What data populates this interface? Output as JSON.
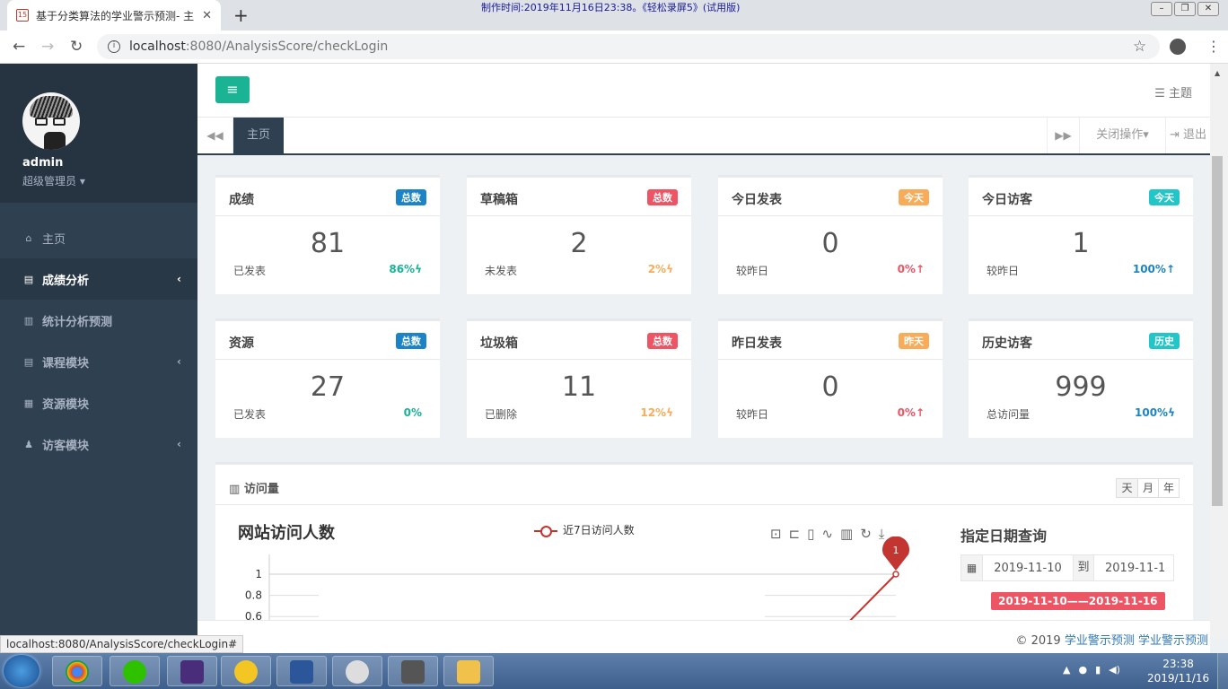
{
  "browser": {
    "tab_title": "基于分类算法的学业警示预测- 主",
    "tab_close": "✕",
    "new_tab": "+",
    "url_host": "localhost",
    "url_rest": ":8080/AnalysisScore/checkLogin",
    "recorder_watermark": "制作时间:2019年11月16日23:38。《轻松录屏5》(试用版)",
    "status_url": "localhost:8080/AnalysisScore/checkLogin#"
  },
  "sidebar": {
    "username": "admin",
    "role": "超级管理员",
    "items": [
      {
        "label": "主页",
        "icon": "home-icon",
        "glyph": "⌂",
        "chev": ""
      },
      {
        "label": "成绩分析",
        "icon": "book-icon",
        "glyph": "▤",
        "chev": "‹"
      },
      {
        "label": "统计分析预测",
        "icon": "bar-chart-icon",
        "glyph": "▥",
        "chev": ""
      },
      {
        "label": "课程模块",
        "icon": "book-icon",
        "glyph": "▤",
        "chev": "‹"
      },
      {
        "label": "资源模块",
        "icon": "table-icon",
        "glyph": "▦",
        "chev": ""
      },
      {
        "label": "访客模块",
        "icon": "user-icon",
        "glyph": "♟",
        "chev": "‹"
      }
    ]
  },
  "header": {
    "menu_toggle": "≡",
    "theme_label": "主题"
  },
  "tabs": {
    "home": "主页",
    "close_ops": "关闭操作",
    "logout": "退出"
  },
  "stats": [
    {
      "title": "成绩",
      "badge": "总数",
      "badge_color": "#1c84c6",
      "value": "81",
      "sub": "已发表",
      "pct": "86%",
      "pct_icon": "ϟ",
      "pct_color": "#1ab394"
    },
    {
      "title": "草稿箱",
      "badge": "总数",
      "badge_color": "#ed5565",
      "value": "2",
      "sub": "未发表",
      "pct": "2%",
      "pct_icon": "ϟ",
      "pct_color": "#f8ac59"
    },
    {
      "title": "今日发表",
      "badge": "今天",
      "badge_color": "#f8ac59",
      "value": "0",
      "sub": "较昨日",
      "pct": "0%",
      "pct_icon": "↑",
      "pct_color": "#ed5565"
    },
    {
      "title": "今日访客",
      "badge": "今天",
      "badge_color": "#23c6c8",
      "value": "1",
      "sub": "较昨日",
      "pct": "100%",
      "pct_icon": "↑",
      "pct_color": "#1c84c6"
    },
    {
      "title": "资源",
      "badge": "总数",
      "badge_color": "#1c84c6",
      "value": "27",
      "sub": "已发表",
      "pct": "0%",
      "pct_icon": "",
      "pct_color": "#1ab394"
    },
    {
      "title": "垃圾箱",
      "badge": "总数",
      "badge_color": "#ed5565",
      "value": "11",
      "sub": "已删除",
      "pct": "12%",
      "pct_icon": "ϟ",
      "pct_color": "#f8ac59"
    },
    {
      "title": "昨日发表",
      "badge": "昨天",
      "badge_color": "#f8ac59",
      "value": "0",
      "sub": "较昨日",
      "pct": "0%",
      "pct_icon": "↑",
      "pct_color": "#ed5565"
    },
    {
      "title": "历史访客",
      "badge": "历史",
      "badge_color": "#23c6c8",
      "value": "999",
      "sub": "总访问量",
      "pct": "100%",
      "pct_icon": "ϟ",
      "pct_color": "#1c84c6"
    }
  ],
  "visits_panel": {
    "title": "访问量",
    "period_buttons": [
      "天",
      "月",
      "年"
    ],
    "date_query_title": "指定日期查询",
    "date_from": "2019-11-10",
    "date_to_label": "到",
    "date_to": "2019-11-1",
    "range_badge": "2019-11-10——2019-11-16"
  },
  "chart_data": {
    "type": "line",
    "title": "网站访问人数",
    "series": [
      {
        "name": "近7日访问人数",
        "values": [
          0,
          0,
          0,
          0,
          0,
          0,
          1
        ]
      }
    ],
    "yticks": [
      "1",
      "0.8",
      "0.6"
    ],
    "ylim": [
      0,
      1
    ],
    "visible_ylim": [
      0.6,
      1
    ],
    "markpoint": "1",
    "line_color": "#c23531"
  },
  "footer": {
    "copyright": "© 2019",
    "link1": "学业警示预测",
    "link2": "学业警示预测"
  },
  "taskbar": {
    "time": "23:38",
    "date": "2019/11/16"
  }
}
